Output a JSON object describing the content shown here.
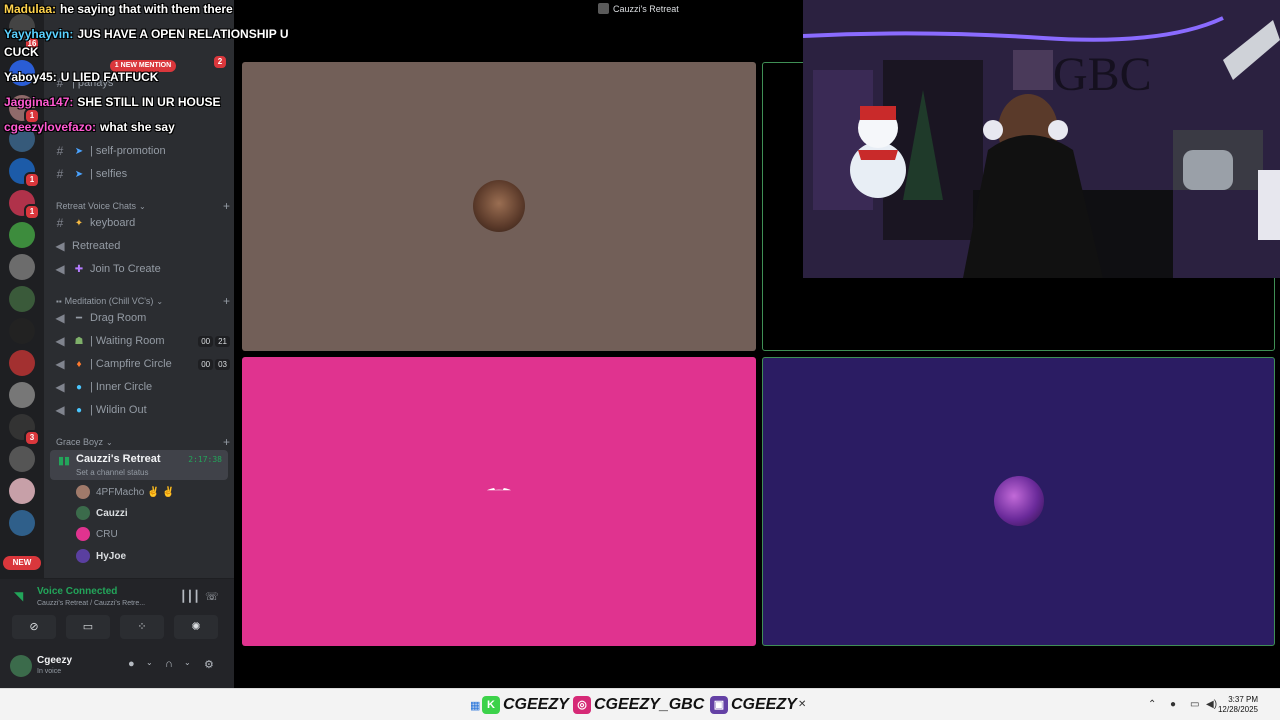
{
  "window": {
    "title": "Cauzzi's Retreat"
  },
  "notifications": {
    "new_mention": "1 NEW MENTION",
    "new_pill": "NEW"
  },
  "server_rail": {
    "badges": [
      "16",
      "1",
      "1",
      "2",
      "1",
      "3"
    ]
  },
  "sidebar": {
    "text_channels": [
      {
        "label": "| parlays"
      },
      {
        "label": "| self-promotion"
      },
      {
        "label": "| selfies"
      }
    ],
    "retreat_category": "Retreat Voice Chats",
    "retreat_channels": [
      {
        "label": "keyboard"
      },
      {
        "label": "Retreated"
      },
      {
        "label": "Join To Create"
      }
    ],
    "meditation_category": "Meditation (Chill VC's)",
    "meditation_channels": [
      {
        "label": "Drag Room",
        "counts": []
      },
      {
        "label": "| Waiting Room",
        "counts": [
          "00",
          "21"
        ]
      },
      {
        "label": "| Campfire Circle",
        "counts": [
          "00",
          "03"
        ]
      },
      {
        "label": "| Inner Circle",
        "counts": []
      },
      {
        "label": "| Wildin Out",
        "counts": []
      }
    ],
    "grace_category": "Grace Boyz",
    "active_channel": {
      "name": "Cauzzi's Retreat",
      "status": "Set a channel status",
      "time": "2:17:38"
    },
    "members": [
      {
        "name": "4PFMacho ✌ ✌"
      },
      {
        "name": "Cauzzi"
      },
      {
        "name": "CRU"
      },
      {
        "name": "HyJoe"
      }
    ]
  },
  "voice_panel": {
    "title": "Voice Connected",
    "subtitle": "Cauzzi's Retreat / Cauzzi's Retre...",
    "user_name": "Cgeezy",
    "user_status": "In voice"
  },
  "chat": [
    {
      "user": "Madulaa:",
      "user_color": "#ffd34d",
      "text": "he saying that with them there"
    },
    {
      "user": "Yayyhayvin:",
      "user_color": "#5ad1ff",
      "text": "JUS HAVE A OPEN RELATIONSHIP U"
    },
    {
      "user": "",
      "user_color": "#ffffff",
      "text": "CUCK"
    },
    {
      "user": "Yaboy45:",
      "user_color": "#ffffff",
      "text": "U LIED FATFUCK"
    },
    {
      "user": "Jaggina147:",
      "user_color": "#ff5ad2",
      "text": "SHE STILL IN UR HOUSE"
    },
    {
      "user": "cgeezylovefazo:",
      "user_color": "#ff5ad2",
      "text": "what she say"
    }
  ],
  "taskbar": {
    "handles": [
      {
        "icon": "K",
        "color": "#3cd24a",
        "text": "CGEEZY"
      },
      {
        "icon": "◎",
        "color": "#d62976",
        "text": "CGEEZY_GBC"
      },
      {
        "icon": "▣",
        "color": "#6441a5",
        "text": "CGEEZY"
      }
    ],
    "time": "3:37 PM",
    "date": "12/28/2025"
  },
  "colors": {
    "accent_green": "#23a55a",
    "tile_pink": "#e0338f",
    "tile_purple": "#2b1c63",
    "tile_brown": "#725f58"
  }
}
